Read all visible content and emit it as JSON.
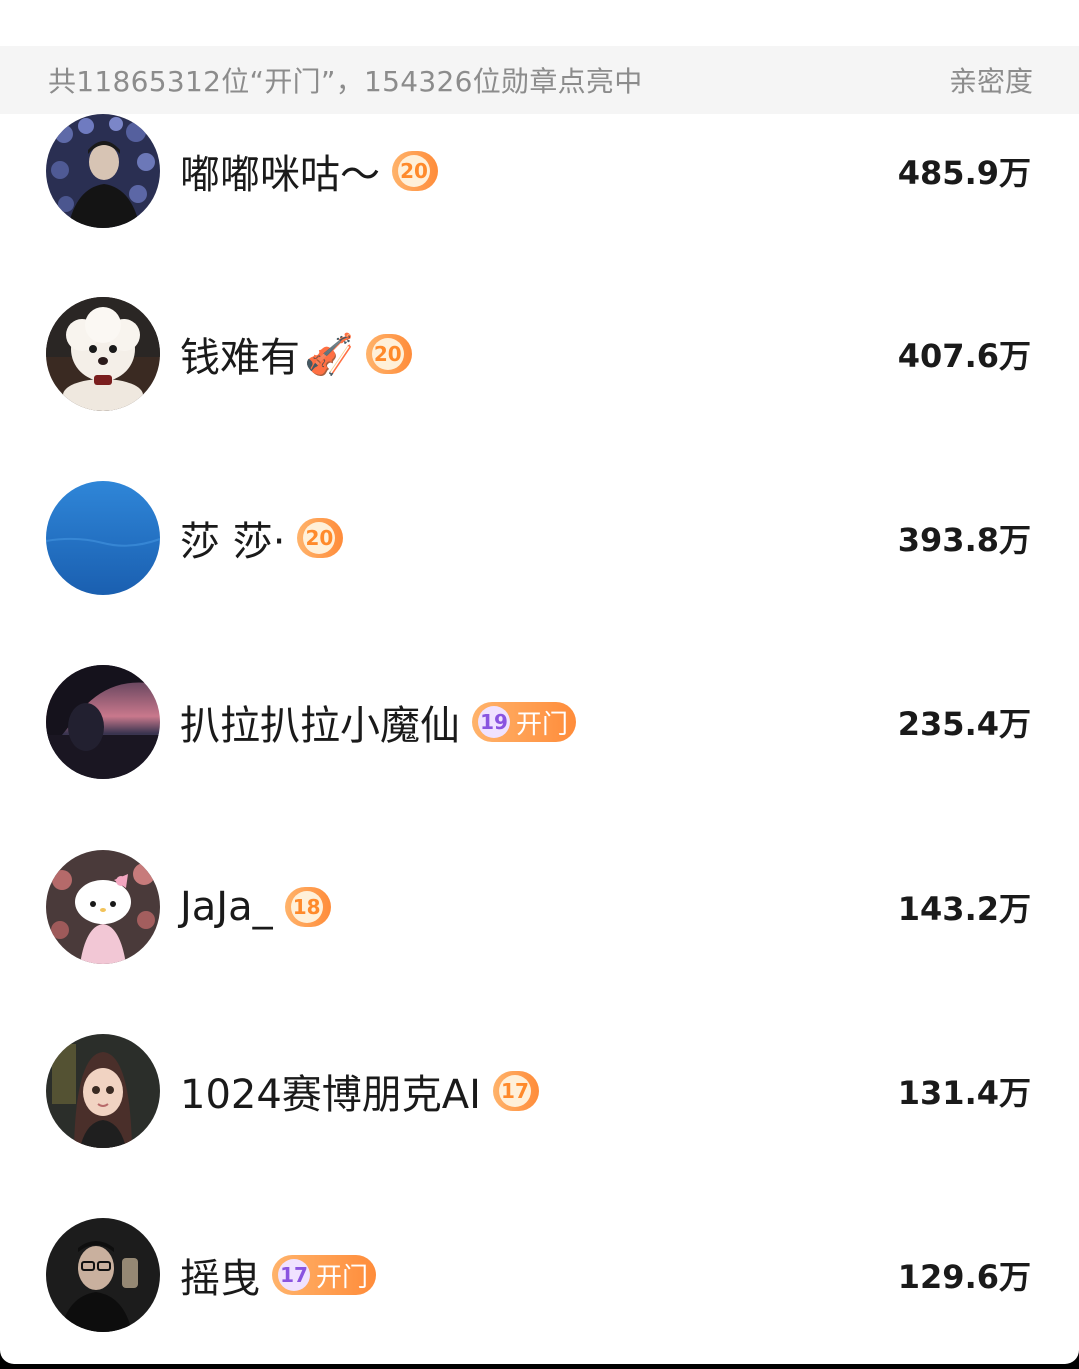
{
  "header": {
    "summary": "共11865312位“开门”，154326位勋章点亮中",
    "column_label": "亲密度"
  },
  "rows": [
    {
      "name": "嘟嘟咪咕～",
      "level": "20",
      "badge_text": "",
      "value": "485.9万",
      "avatar_icon": "avatar-flowers-portrait"
    },
    {
      "name": "钱难有",
      "emoji": "🎻",
      "level": "20",
      "badge_text": "",
      "value": "407.6万",
      "avatar_icon": "avatar-white-poodle"
    },
    {
      "name": "莎 莎·",
      "level": "20",
      "badge_text": "",
      "value": "393.8万",
      "avatar_icon": "avatar-blue-ocean"
    },
    {
      "name": "扒拉扒拉小魔仙",
      "level": "19",
      "badge_text": "开门",
      "value": "235.4万",
      "avatar_icon": "avatar-car-sunset"
    },
    {
      "name": "JaJa_",
      "level": "18",
      "badge_text": "",
      "value": "143.2万",
      "avatar_icon": "avatar-hello-kitty"
    },
    {
      "name": "1024赛博朋克AI",
      "level": "17",
      "badge_text": "",
      "value": "131.4万",
      "avatar_icon": "avatar-cartoon-girl"
    },
    {
      "name": "摇曳",
      "level": "17",
      "badge_text": "开门",
      "value": "129.6万",
      "avatar_icon": "avatar-man-glasses"
    }
  ],
  "colors": {
    "badge_orange": "#ff8c3a",
    "header_bg": "#f5f5f5",
    "text_primary": "#1a1a1a",
    "text_secondary": "#8c8c8c"
  }
}
